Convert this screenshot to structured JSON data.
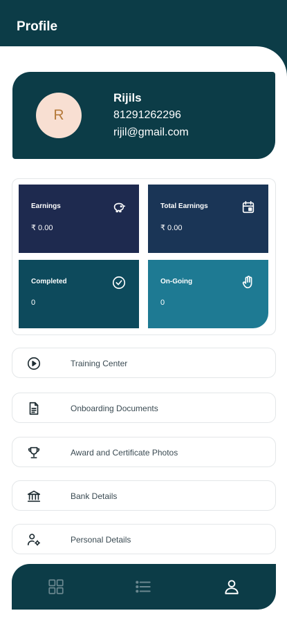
{
  "header": {
    "title": "Profile"
  },
  "profile": {
    "initial": "R",
    "name": "Rijils",
    "phone": "81291262296",
    "email": "rijil@gmail.com"
  },
  "stats": [
    {
      "label": "Earnings",
      "value": "₹ 0.00",
      "icon": "piggy-bank-icon"
    },
    {
      "label": "Total Earnings",
      "value": "₹ 0.00",
      "icon": "calendar-icon"
    },
    {
      "label": "Completed",
      "value": "0",
      "icon": "check-circle-icon"
    },
    {
      "label": "On-Going",
      "value": "0",
      "icon": "hand-icon"
    }
  ],
  "menu": [
    {
      "label": "Training Center",
      "icon": "play-circle-icon"
    },
    {
      "label": "Onboarding Documents",
      "icon": "document-icon"
    },
    {
      "label": "Award and Certificate Photos",
      "icon": "trophy-icon"
    },
    {
      "label": "Bank Details",
      "icon": "bank-icon"
    },
    {
      "label": "Personal Details",
      "icon": "user-settings-icon"
    }
  ],
  "bottom_nav": [
    {
      "name": "dashboard",
      "icon": "grid-icon",
      "active": false
    },
    {
      "name": "list",
      "icon": "list-icon",
      "active": false
    },
    {
      "name": "profile",
      "icon": "user-icon",
      "active": true
    }
  ],
  "colors": {
    "primary": "#0c3c47",
    "avatar_bg": "#f8dfd2",
    "earnings": "#1e2a4f",
    "total_earnings": "#1a3556",
    "completed": "#0d4a5c",
    "ongoing": "#1e7a93"
  }
}
